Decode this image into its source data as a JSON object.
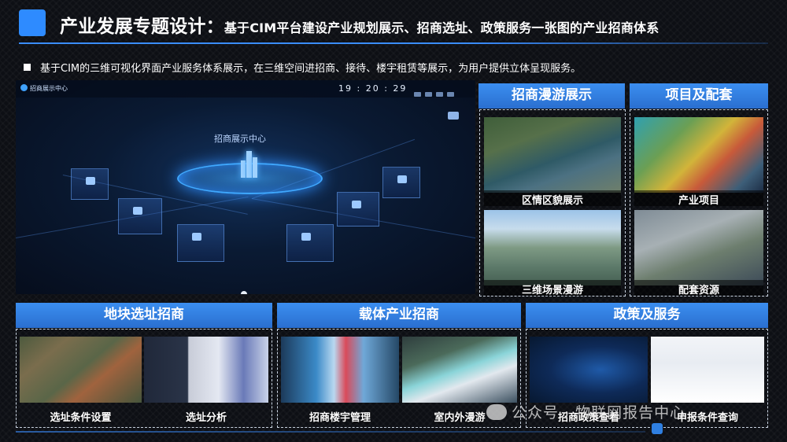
{
  "header": {
    "title_main": "产业发展专题设计：",
    "title_sub": "基于CIM平台建设产业规划展示、招商选址、政策服务一张图的产业招商体系"
  },
  "bullet": "基于CIM的三维可视化界面产业服务体系展示，在三维空间进招商、接待、楼宇租赁等展示，为用户提供立体呈现服务。",
  "hero": {
    "app_title": "招商展示中心",
    "time": "19 : 20 : 29",
    "center_label": "招商展示中心"
  },
  "panels": {
    "roam": {
      "title": "招商漫游展示",
      "captions": [
        "区情区貌展示",
        "三维场景漫游"
      ]
    },
    "project": {
      "title": "项目及配套",
      "captions": [
        "产业项目",
        "配套资源"
      ]
    },
    "land": {
      "title": "地块选址招商",
      "captions": [
        "选址条件设置",
        "选址分析"
      ]
    },
    "carrier": {
      "title": "载体产业招商",
      "captions": [
        "招商楼宇管理",
        "室内外漫游"
      ]
    },
    "policy": {
      "title": "政策及服务",
      "captions": [
        "招商政策查看",
        "申报条件查询"
      ]
    }
  },
  "watermark": "公众号 · 物联网报告中心",
  "colors": {
    "accent": "#2e8bff",
    "panel_head": "#3b8ef0"
  }
}
